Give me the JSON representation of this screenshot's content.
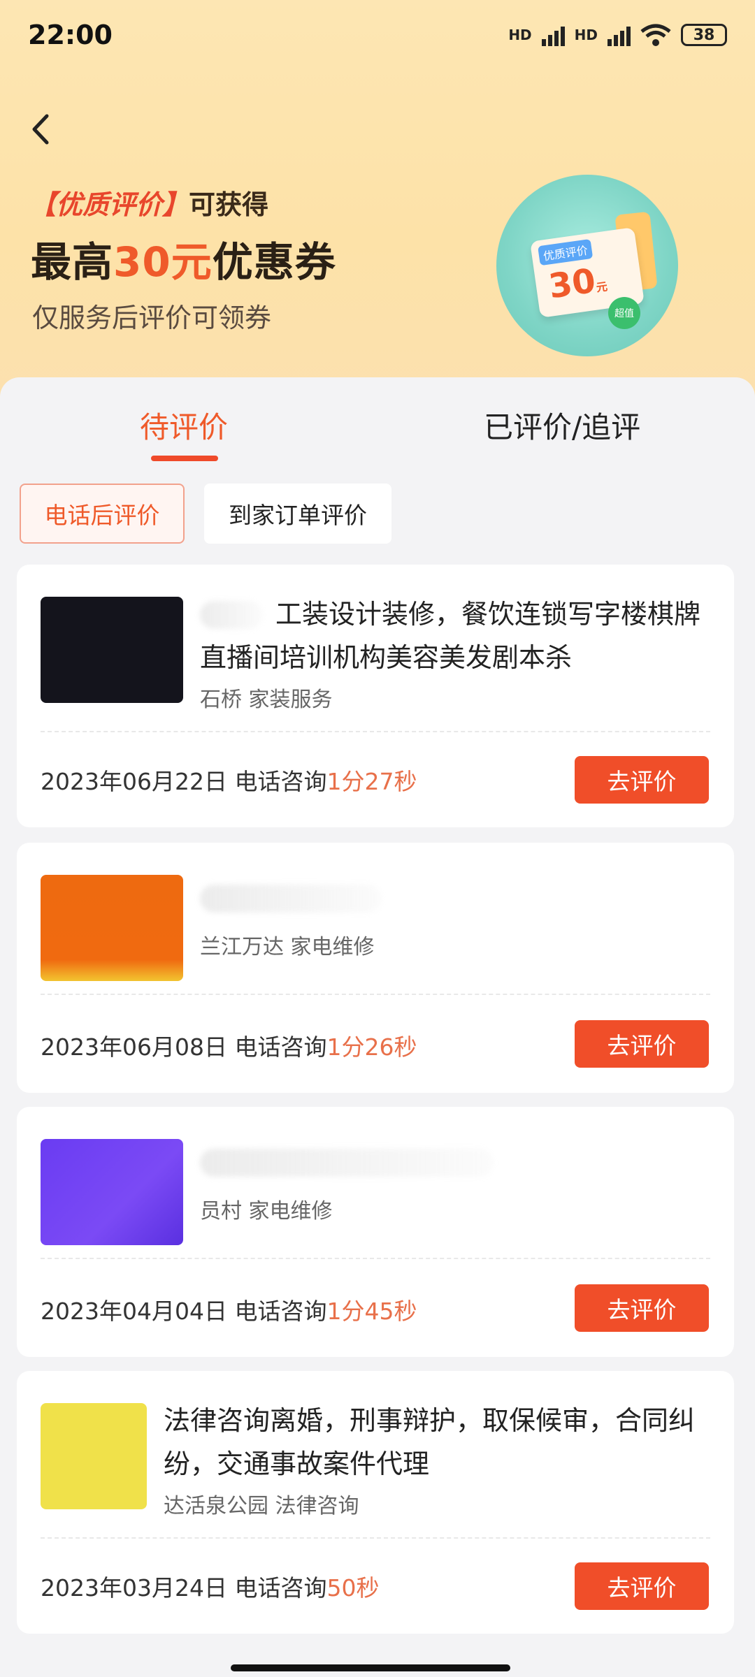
{
  "status_bar": {
    "time": "22:00",
    "battery": "38",
    "net1": "HD",
    "net2": "HD"
  },
  "promo": {
    "line1_highlight": "【优质评价】",
    "line1_rest": "可获得",
    "line2_pre": "最高",
    "line2_amount": "30元",
    "line2_post": "优惠券",
    "line3": "仅服务后评价可领券",
    "art": {
      "tag": "优质评价",
      "value": "30",
      "unit": "元",
      "badge": "超值"
    }
  },
  "tabs": [
    {
      "label": "待评价",
      "active": true
    },
    {
      "label": "已评价/追评",
      "active": false
    }
  ],
  "chips": [
    {
      "label": "电话后评价",
      "active": true
    },
    {
      "label": "到家订单评价",
      "active": false
    }
  ],
  "cards": [
    {
      "title": "工装设计装修，餐饮连锁写字楼棋牌直播间培训机构美容美发剧本杀",
      "location": "石桥 家装服务",
      "date": "2023年06月22日 电话咨询",
      "duration": "1分27秒",
      "button": "去评价",
      "thumb_color": "#14141c"
    },
    {
      "title": "",
      "location": "兰江万达 家电维修",
      "date": "2023年06月08日 电话咨询",
      "duration": "1分26秒",
      "button": "去评价",
      "thumb_color": "#ee6a10"
    },
    {
      "title": "",
      "location": "员村 家电维修",
      "date": "2023年04月04日 电话咨询",
      "duration": "1分45秒",
      "button": "去评价",
      "thumb_color": "#6a3cf2"
    },
    {
      "title": "法律咨询离婚，刑事辩护，取保候审，合同纠纷，交通事故案件代理",
      "location": "达活泉公园 法律咨询",
      "date": "2023年03月24日 电话咨询",
      "duration": "50秒",
      "button": "去评价",
      "thumb_color": "#f0e14a"
    }
  ],
  "colors": {
    "accent": "#ef5a2a",
    "button": "#f04e29",
    "duration": "#e8704a"
  }
}
